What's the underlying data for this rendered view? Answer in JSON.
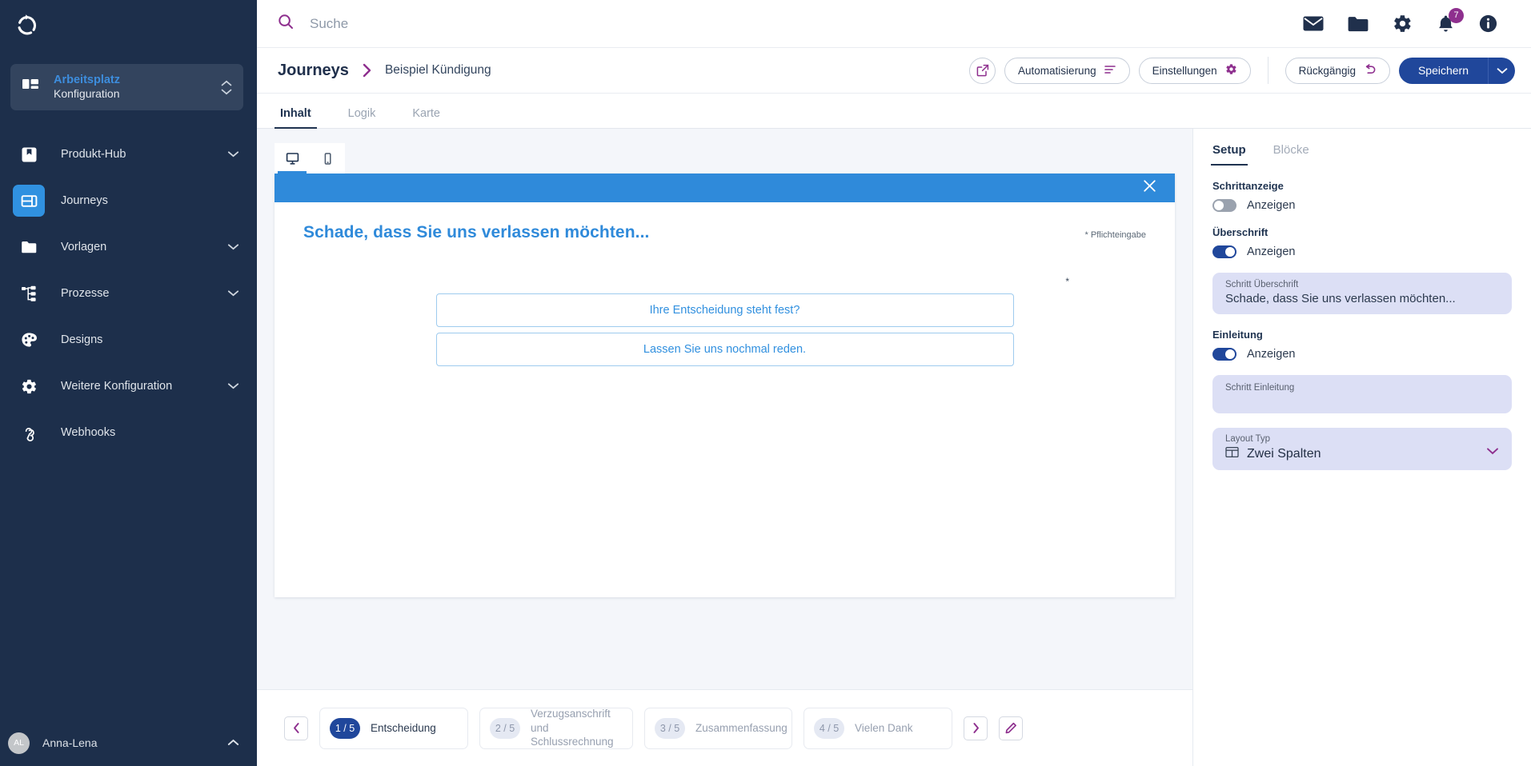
{
  "sidebar": {
    "logo_icon": "refresh-circle-logo",
    "workspace": {
      "title": "Arbeitsplatz",
      "subtitle": "Konfiguration",
      "icon": "dashboard-grid-icon"
    },
    "items": [
      {
        "label": "Produkt-Hub",
        "icon": "product-hub-icon",
        "expandable": true,
        "active": false
      },
      {
        "label": "Journeys",
        "icon": "journeys-icon",
        "expandable": false,
        "active": true
      },
      {
        "label": "Vorlagen",
        "icon": "folder-icon",
        "expandable": true,
        "active": false
      },
      {
        "label": "Prozesse",
        "icon": "process-tree-icon",
        "expandable": true,
        "active": false
      },
      {
        "label": "Designs",
        "icon": "palette-icon",
        "expandable": false,
        "active": false
      },
      {
        "label": "Weitere Konfiguration",
        "icon": "gear-icon",
        "expandable": true,
        "active": false
      },
      {
        "label": "Webhooks",
        "icon": "webhook-icon",
        "expandable": false,
        "active": false
      }
    ],
    "user": {
      "initials": "AL",
      "name": "Anna-Lena"
    }
  },
  "topbar": {
    "search_placeholder": "Suche",
    "search_value": "",
    "icons": [
      {
        "name": "mail-icon"
      },
      {
        "name": "folder-icon"
      },
      {
        "name": "gear-icon"
      },
      {
        "name": "bell-icon",
        "badge": "7"
      },
      {
        "name": "info-icon"
      }
    ]
  },
  "breadcrumb": {
    "root": "Journeys",
    "leaf": "Beispiel Kündigung"
  },
  "header_actions": {
    "open_external_icon": "external-link-icon",
    "automation_label": "Automatisierung",
    "automation_icon": "automation-lines-icon",
    "settings_label": "Einstellungen",
    "settings_icon": "gear-icon",
    "undo_label": "Rückgängig",
    "undo_icon": "undo-arrow-icon",
    "save_label": "Speichern",
    "save_caret_icon": "chevron-down-icon"
  },
  "tabs": [
    {
      "label": "Inhalt",
      "active": true
    },
    {
      "label": "Logik",
      "active": false
    },
    {
      "label": "Karte",
      "active": false
    }
  ],
  "preview": {
    "device_tabs": [
      {
        "name": "desktop-icon",
        "active": true
      },
      {
        "name": "mobile-icon",
        "active": false
      }
    ],
    "close_icon": "close-icon",
    "header_color": "#2f8ada",
    "title": "Schade, dass Sie uns verlassen möchten...",
    "required_note": "* Pflichteingabe",
    "required_marker": "*",
    "choices": [
      "Ihre Entscheidung steht fest?",
      "Lassen Sie uns nochmal reden."
    ]
  },
  "steps": {
    "prev_icon": "chevron-left-icon",
    "next_icon": "chevron-right-icon",
    "edit_icon": "pencil-icon",
    "items": [
      {
        "counter": "1 / 5",
        "label": "Entscheidung",
        "active": true
      },
      {
        "counter": "2 / 5",
        "label": "Verzugsanschrift und Schlussrechnung",
        "active": false
      },
      {
        "counter": "3 / 5",
        "label": "Zusammenfassung",
        "active": false
      },
      {
        "counter": "4 / 5",
        "label": "Vielen Dank",
        "active": false
      }
    ]
  },
  "right_panel": {
    "tabs": [
      {
        "label": "Setup",
        "active": true
      },
      {
        "label": "Blöcke",
        "active": false
      }
    ],
    "step_indicator": {
      "label": "Schrittanzeige",
      "toggle_label": "Anzeigen",
      "toggle_on": false
    },
    "heading": {
      "label": "Überschrift",
      "toggle_label": "Anzeigen",
      "toggle_on": true,
      "field_label": "Schritt Überschrift",
      "field_value": "Schade, dass Sie uns verlassen möchten..."
    },
    "intro": {
      "label": "Einleitung",
      "toggle_label": "Anzeigen",
      "toggle_on": true,
      "field_label": "Schritt Einleitung",
      "field_value": ""
    },
    "layout": {
      "field_label": "Layout Typ",
      "value": "Zwei Spalten",
      "icon": "two-columns-layout-icon",
      "caret_icon": "chevron-down-icon"
    }
  },
  "colors": {
    "sidebar_bg": "#1d2f4b",
    "accent_purple": "#8e2f8e",
    "accent_blue": "#2f8ada",
    "primary_blue": "#20479b",
    "field_lilac": "#dcdff5"
  }
}
